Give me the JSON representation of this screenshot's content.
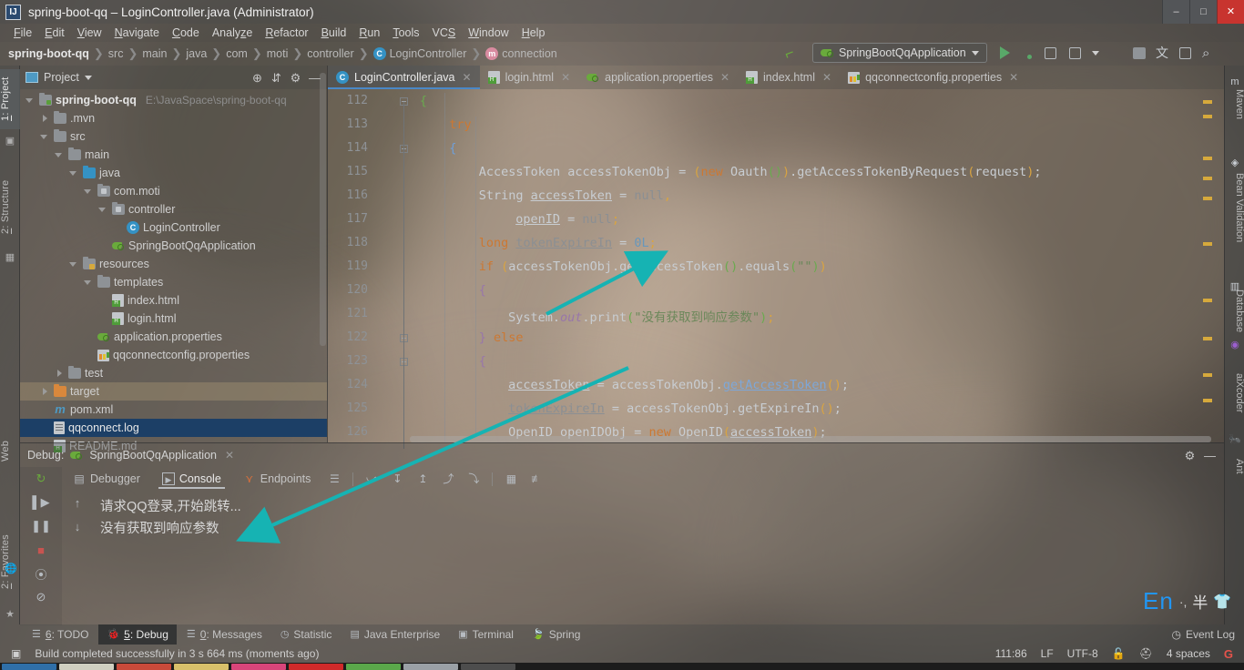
{
  "window": {
    "title": "spring-boot-qq – LoginController.java (Administrator)",
    "logo": "intellij-idea-logo",
    "minimize": "–",
    "maximize": "□",
    "close": "✕"
  },
  "menubar": {
    "items": [
      {
        "label": "File",
        "mnemonic": "F"
      },
      {
        "label": "Edit",
        "mnemonic": "E"
      },
      {
        "label": "View",
        "mnemonic": "V"
      },
      {
        "label": "Navigate",
        "mnemonic": "N"
      },
      {
        "label": "Code",
        "mnemonic": "C"
      },
      {
        "label": "Analyze",
        "mnemonic": "z"
      },
      {
        "label": "Refactor",
        "mnemonic": "R"
      },
      {
        "label": "Build",
        "mnemonic": "B"
      },
      {
        "label": "Run",
        "mnemonic": "R"
      },
      {
        "label": "Tools",
        "mnemonic": "T"
      },
      {
        "label": "VCS",
        "mnemonic": "S"
      },
      {
        "label": "Window",
        "mnemonic": "W"
      },
      {
        "label": "Help",
        "mnemonic": "H"
      }
    ]
  },
  "navbar": {
    "crumbs": [
      {
        "label": "spring-boot-qq",
        "icon": "none"
      },
      {
        "label": "src",
        "icon": "none"
      },
      {
        "label": "main",
        "icon": "none"
      },
      {
        "label": "java",
        "icon": "none"
      },
      {
        "label": "com",
        "icon": "none"
      },
      {
        "label": "moti",
        "icon": "none"
      },
      {
        "label": "controller",
        "icon": "none"
      },
      {
        "label": "LoginController",
        "icon": "class-badge-c"
      },
      {
        "label": "connection",
        "icon": "method-badge-m"
      }
    ],
    "hammer_icon": "build-hammer-icon",
    "run_config": "SpringBootQqApplication",
    "toolbar_icons": [
      "run-icon",
      "debug-icon",
      "run-with-coverage-icon",
      "profile-icon",
      "stop-icon",
      "build-project-icon",
      "translate-icon",
      "console-icon",
      "search-everywhere-icon"
    ]
  },
  "left_strip": {
    "tabs": [
      {
        "label": "1: Project",
        "mnemonic": "1",
        "active": true
      },
      {
        "label": "2: Structure",
        "mnemonic": "2",
        "active": false
      },
      {
        "label": "Web",
        "active": false
      },
      {
        "label": "2: Favorites",
        "mnemonic": "2",
        "active": false
      }
    ]
  },
  "right_strip": {
    "tabs": [
      {
        "label": "Maven"
      },
      {
        "label": "Bean Validation"
      },
      {
        "label": "Database"
      },
      {
        "label": "aiXcoder"
      },
      {
        "label": "Ant"
      }
    ]
  },
  "project_panel": {
    "title": "Project",
    "icons": [
      "locate-icon",
      "collapse-all-icon",
      "settings-gear-icon",
      "hide-icon"
    ],
    "tree": [
      {
        "label": "spring-boot-qq",
        "path": "E:\\JavaSpace\\spring-boot-qq",
        "indent": 0,
        "arrow": "down",
        "icon": "module-folder",
        "bold": true
      },
      {
        "label": ".mvn",
        "indent": 1,
        "arrow": "right",
        "icon": "folder-gray"
      },
      {
        "label": "src",
        "indent": 1,
        "arrow": "down",
        "icon": "folder-gray"
      },
      {
        "label": "main",
        "indent": 2,
        "arrow": "down",
        "icon": "folder-gray"
      },
      {
        "label": "java",
        "indent": 3,
        "arrow": "down",
        "icon": "folder-blue-source"
      },
      {
        "label": "com.moti",
        "indent": 4,
        "arrow": "down",
        "icon": "package"
      },
      {
        "label": "controller",
        "indent": 5,
        "arrow": "down",
        "icon": "package"
      },
      {
        "label": "LoginController",
        "indent": 6,
        "arrow": "none",
        "icon": "java-class"
      },
      {
        "label": "SpringBootQqApplication",
        "indent": 5,
        "arrow": "none",
        "icon": "spring-boot-class"
      },
      {
        "label": "resources",
        "indent": 3,
        "arrow": "down",
        "icon": "folder-resources"
      },
      {
        "label": "templates",
        "indent": 4,
        "arrow": "down",
        "icon": "folder-gray"
      },
      {
        "label": "index.html",
        "indent": 5,
        "arrow": "none",
        "icon": "html-file"
      },
      {
        "label": "login.html",
        "indent": 5,
        "arrow": "none",
        "icon": "html-file"
      },
      {
        "label": "application.properties",
        "indent": 4,
        "arrow": "none",
        "icon": "spring-properties"
      },
      {
        "label": "qqconnectconfig.properties",
        "indent": 4,
        "arrow": "none",
        "icon": "properties-file"
      },
      {
        "label": "test",
        "indent": 2,
        "arrow": "right",
        "icon": "folder-gray"
      },
      {
        "label": "target",
        "indent": 1,
        "arrow": "right",
        "icon": "folder-orange",
        "highlight": "tan"
      },
      {
        "label": "pom.xml",
        "indent": 1,
        "arrow": "none",
        "icon": "maven-file"
      },
      {
        "label": "qqconnect.log",
        "indent": 1,
        "arrow": "none",
        "icon": "log-file",
        "highlight": "blue"
      },
      {
        "label": "README.md",
        "indent": 1,
        "arrow": "none",
        "icon": "markdown-file"
      }
    ]
  },
  "editor": {
    "tabs": [
      {
        "label": "LoginController.java",
        "icon": "java-class",
        "active": true
      },
      {
        "label": "login.html",
        "icon": "html-file",
        "active": false
      },
      {
        "label": "application.properties",
        "icon": "spring-properties",
        "active": false
      },
      {
        "label": "index.html",
        "icon": "html-file",
        "active": false
      },
      {
        "label": "qqconnectconfig.properties",
        "icon": "properties-file",
        "active": false
      }
    ],
    "first_line_number": 112,
    "lines": [
      {
        "n": 112,
        "text": "{"
      },
      {
        "n": 113,
        "text": "try"
      },
      {
        "n": 114,
        "text": "{"
      },
      {
        "n": 115,
        "text": "AccessToken accessTokenObj = (new Oauth()).getAccessTokenByRequest(request);"
      },
      {
        "n": 116,
        "text": "String accessToken = null,"
      },
      {
        "n": 117,
        "text": "openID = null;"
      },
      {
        "n": 118,
        "text": "long tokenExpireIn = 0L;"
      },
      {
        "n": 119,
        "text": "if (accessTokenObj.getAccessToken().equals(\"\"))"
      },
      {
        "n": 120,
        "text": "{"
      },
      {
        "n": 121,
        "text": "System.out.print(\"没有获取到响应参数\");"
      },
      {
        "n": 122,
        "text": "} else"
      },
      {
        "n": 123,
        "text": "{"
      },
      {
        "n": 124,
        "text": "accessToken = accessTokenObj.getAccessToken();"
      },
      {
        "n": 125,
        "text": "tokenExpireIn = accessTokenObj.getExpireIn();"
      },
      {
        "n": 126,
        "text": "OpenID openIDObj = new OpenID(accessToken);"
      }
    ]
  },
  "debug_panel": {
    "label": "Debug:",
    "config_name": "SpringBootQqApplication",
    "close": "✕",
    "settings_icon": "settings-gear-icon",
    "hide_icon": "hide-icon",
    "tabs": [
      {
        "label": "Debugger",
        "icon": "debugger-icon",
        "active": false
      },
      {
        "label": "Console",
        "icon": "console-icon",
        "active": true
      },
      {
        "label": "Endpoints",
        "icon": "endpoints-icon",
        "active": false
      }
    ],
    "toolbar_icons": [
      "layout-icon",
      "step-over-icon",
      "step-into-icon",
      "force-step-into-icon",
      "step-out-icon",
      "drop-frame-icon",
      "run-to-cursor-icon",
      "evaluate-expression-icon",
      "mute-breakpoints-icon"
    ],
    "side_icons": [
      "rerun-icon",
      "resume-icon",
      "pause-icon",
      "stop-icon",
      "view-breakpoints-icon",
      "mute-breakpoints-icon"
    ],
    "console_lines": [
      "请求QQ登录,开始跳转...",
      "没有获取到响应参数"
    ]
  },
  "ime": {
    "language": "En",
    "dots": "·,",
    "width_mode": "半",
    "extra_icon": "ime-shirt-icon"
  },
  "bottom_tabs": [
    {
      "label": "6: TODO",
      "mnemonic": "6",
      "icon": "todo-icon",
      "active": false
    },
    {
      "label": "5: Debug",
      "mnemonic": "5",
      "icon": "debug-icon",
      "active": true
    },
    {
      "label": "0: Messages",
      "mnemonic": "0",
      "icon": "messages-icon",
      "active": false
    },
    {
      "label": "Statistic",
      "icon": "statistic-icon",
      "active": false
    },
    {
      "label": "Java Enterprise",
      "icon": "java-enterprise-icon",
      "active": false
    },
    {
      "label": "Terminal",
      "icon": "terminal-icon",
      "active": false
    },
    {
      "label": "Spring",
      "icon": "spring-icon",
      "active": false
    }
  ],
  "event_log": {
    "label": "Event Log",
    "icon": "event-log-icon"
  },
  "statusbar": {
    "build_icon": "build-status-icon",
    "message": "Build completed successfully in 3 s 664 ms (moments ago)",
    "caret_position": "111:86",
    "line_separator": "LF",
    "encoding": "UTF-8",
    "lock_icon": "unlocked-icon",
    "hector_icon": "hector-inspection-icon",
    "indent": "4 spaces",
    "git_icon": "google-icon"
  },
  "colors": {
    "accent_blue": "#4a88c7",
    "keyword_orange": "#cc7832",
    "string_green": "#6a8759",
    "field_purple": "#9876aa",
    "method_blue": "#7da7d9",
    "selection_blue": "#1c3f66",
    "run_green": "#59a869",
    "stop_red": "#c75450",
    "annotation_teal": "#16b3b3"
  }
}
